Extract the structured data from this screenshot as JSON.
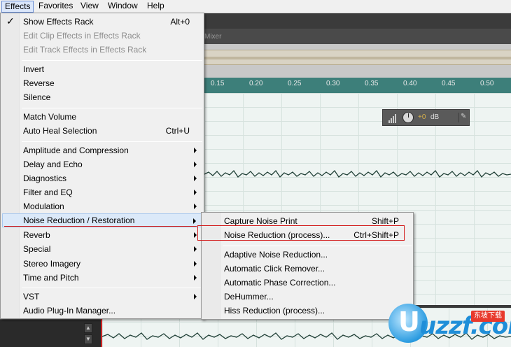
{
  "menubar": {
    "items": [
      "Effects",
      "Favorites",
      "View",
      "Window",
      "Help"
    ]
  },
  "editor": {
    "mixer_tab": "Mixer",
    "ruler_labels": [
      "0.15",
      "0.20",
      "0.25",
      "0.30",
      "0.35",
      "0.40",
      "0.45",
      "0.50"
    ]
  },
  "hud": {
    "value": "+0",
    "unit": "dB"
  },
  "effects_menu": {
    "items": [
      {
        "label": "Show Effects Rack",
        "shortcut": "Alt+0",
        "checked": true
      },
      {
        "label": "Edit Clip Effects in Effects Rack",
        "disabled": true
      },
      {
        "label": "Edit Track Effects in Effects Rack",
        "disabled": true
      },
      {
        "label": "Invert"
      },
      {
        "label": "Reverse"
      },
      {
        "label": "Silence"
      },
      {
        "label": "Match Volume"
      },
      {
        "label": "Auto Heal Selection",
        "shortcut": "Ctrl+U"
      },
      {
        "label": "Amplitude and Compression",
        "submenu": true
      },
      {
        "label": "Delay and Echo",
        "submenu": true
      },
      {
        "label": "Diagnostics",
        "submenu": true
      },
      {
        "label": "Filter and EQ",
        "submenu": true
      },
      {
        "label": "Modulation",
        "submenu": true
      },
      {
        "label": "Noise Reduction / Restoration",
        "submenu": true,
        "highlighted": true
      },
      {
        "label": "Reverb",
        "submenu": true
      },
      {
        "label": "Special",
        "submenu": true
      },
      {
        "label": "Stereo Imagery",
        "submenu": true
      },
      {
        "label": "Time and Pitch",
        "submenu": true
      },
      {
        "label": "VST",
        "submenu": true
      },
      {
        "label": "Audio Plug-In Manager..."
      }
    ]
  },
  "noise_submenu": {
    "items": [
      {
        "label": "Capture Noise Print",
        "shortcut": "Shift+P"
      },
      {
        "label": "Noise Reduction (process)...",
        "shortcut": "Ctrl+Shift+P"
      },
      {
        "label": "Adaptive Noise Reduction..."
      },
      {
        "label": "Automatic Click Remover..."
      },
      {
        "label": "Automatic Phase Correction..."
      },
      {
        "label": "DeHummer..."
      },
      {
        "label": "Hiss Reduction (process)..."
      }
    ]
  },
  "watermark": {
    "text": "uzzf.com",
    "tag": "东坡下载"
  },
  "colors": {
    "accent_red": "#d21a1a",
    "ruler": "#3d7f7a",
    "waveform": "#1f3f36"
  }
}
